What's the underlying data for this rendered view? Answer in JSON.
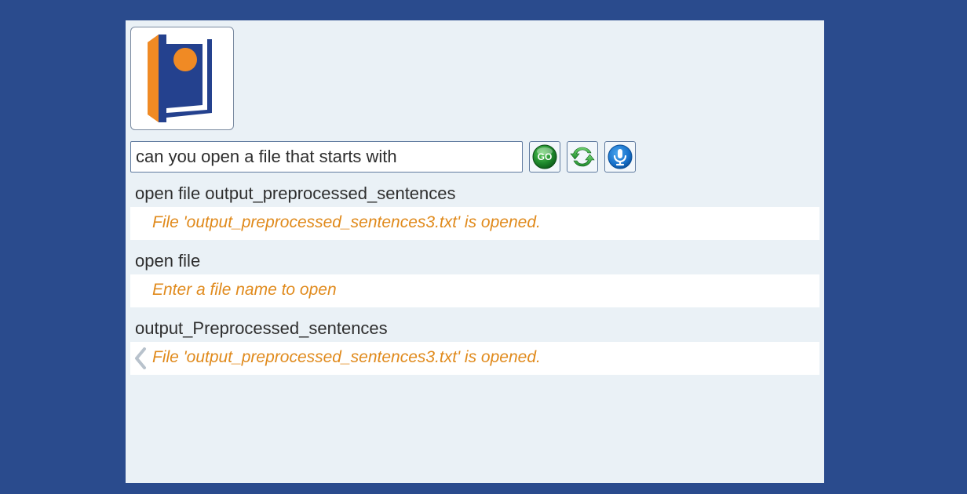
{
  "command_input": {
    "value": "can you open a file that starts with "
  },
  "entries": [
    {
      "query": "open file output_preprocessed_sentences",
      "response": "File 'output_preprocessed_sentences3.txt' is opened.",
      "has_chevron": false
    },
    {
      "query": "open file",
      "response": "Enter a file name to open",
      "has_chevron": false
    },
    {
      "query": "output_Preprocessed_sentences",
      "response": "File 'output_preprocessed_sentences3.txt' is opened.",
      "has_chevron": true
    }
  ]
}
